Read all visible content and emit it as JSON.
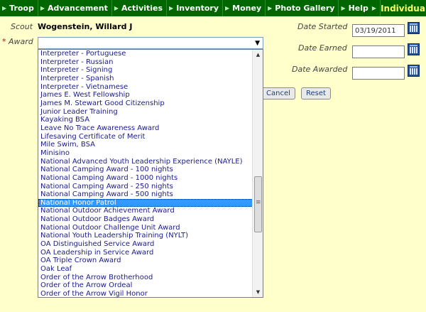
{
  "nav": {
    "items": [
      "Troop",
      "Advancement",
      "Activities",
      "Inventory",
      "Money",
      "Photo Gallery",
      "Help"
    ],
    "title": "Individua"
  },
  "form": {
    "scout_label": "Scout",
    "scout_name": "Wogenstein, Willard J",
    "award_required_mark": "*",
    "award_label": "Award",
    "award_value": "",
    "date_started_label": "Date Started",
    "date_started_value": "03/19/2011",
    "date_earned_label": "Date Earned",
    "date_earned_value": "",
    "date_awarded_label": "Date Awarded",
    "date_awarded_value": "",
    "cancel_label": "Cancel",
    "reset_label": "Reset"
  },
  "award_list": {
    "selected": "National Honor Patrol",
    "scroll_fraction": 0.52,
    "options": [
      "Interpreter - Portuguese",
      "Interpreter - Russian",
      "Interpreter - Signing",
      "Interpreter - Spanish",
      "Interpreter - Vietnamese",
      "James E. West Fellowship",
      "James M. Stewart Good Citizenship",
      "Junior Leader Training",
      "Kayaking BSA",
      "Leave No Trace Awareness Award",
      "Lifesaving Certificate of Merit",
      "Mile Swim, BSA",
      "Minisino",
      "National Advanced Youth Leadership Experience (NAYLE)",
      "National Camping Award - 100 nights",
      "National Camping Award - 1000 nights",
      "National Camping Award - 250 nights",
      "National Camping Award - 500 nights",
      "National Honor Patrol",
      "National Outdoor Achievement Award",
      "National Outdoor Badges Award",
      "National Outdoor Challenge Unit Award",
      "National Youth Leadership Training (NYLT)",
      "OA Distinguished Service Award",
      "OA Leadership in Service Award",
      "OA Triple Crown Award",
      "Oak Leaf",
      "Order of the Arrow Brotherhood",
      "Order of the Arrow Ordeal",
      "Order of the Arrow Vigil Honor"
    ]
  }
}
